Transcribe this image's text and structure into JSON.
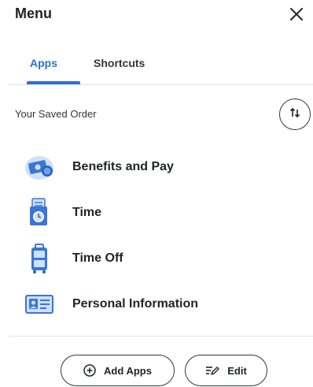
{
  "header": {
    "title": "Menu",
    "close_icon": "close-icon"
  },
  "tabs": [
    {
      "label": "Apps",
      "active": true
    },
    {
      "label": "Shortcuts",
      "active": false
    }
  ],
  "colors": {
    "accent": "#2f6fd6",
    "text": "#1f2328",
    "icon_blue": "#3a76d8",
    "icon_light": "#cfe0fb"
  },
  "section": {
    "label": "Your Saved Order",
    "sort_icon": "sort-arrows-icon"
  },
  "apps": [
    {
      "label": "Benefits and Pay",
      "icon": "benefits-pay-icon"
    },
    {
      "label": "Time",
      "icon": "time-clock-icon"
    },
    {
      "label": "Time Off",
      "icon": "time-off-luggage-icon"
    },
    {
      "label": "Personal Information",
      "icon": "personal-id-card-icon"
    }
  ],
  "footer": {
    "add_apps_label": "Add Apps",
    "add_apps_icon": "plus-circle-icon",
    "edit_label": "Edit",
    "edit_icon": "edit-list-icon"
  }
}
